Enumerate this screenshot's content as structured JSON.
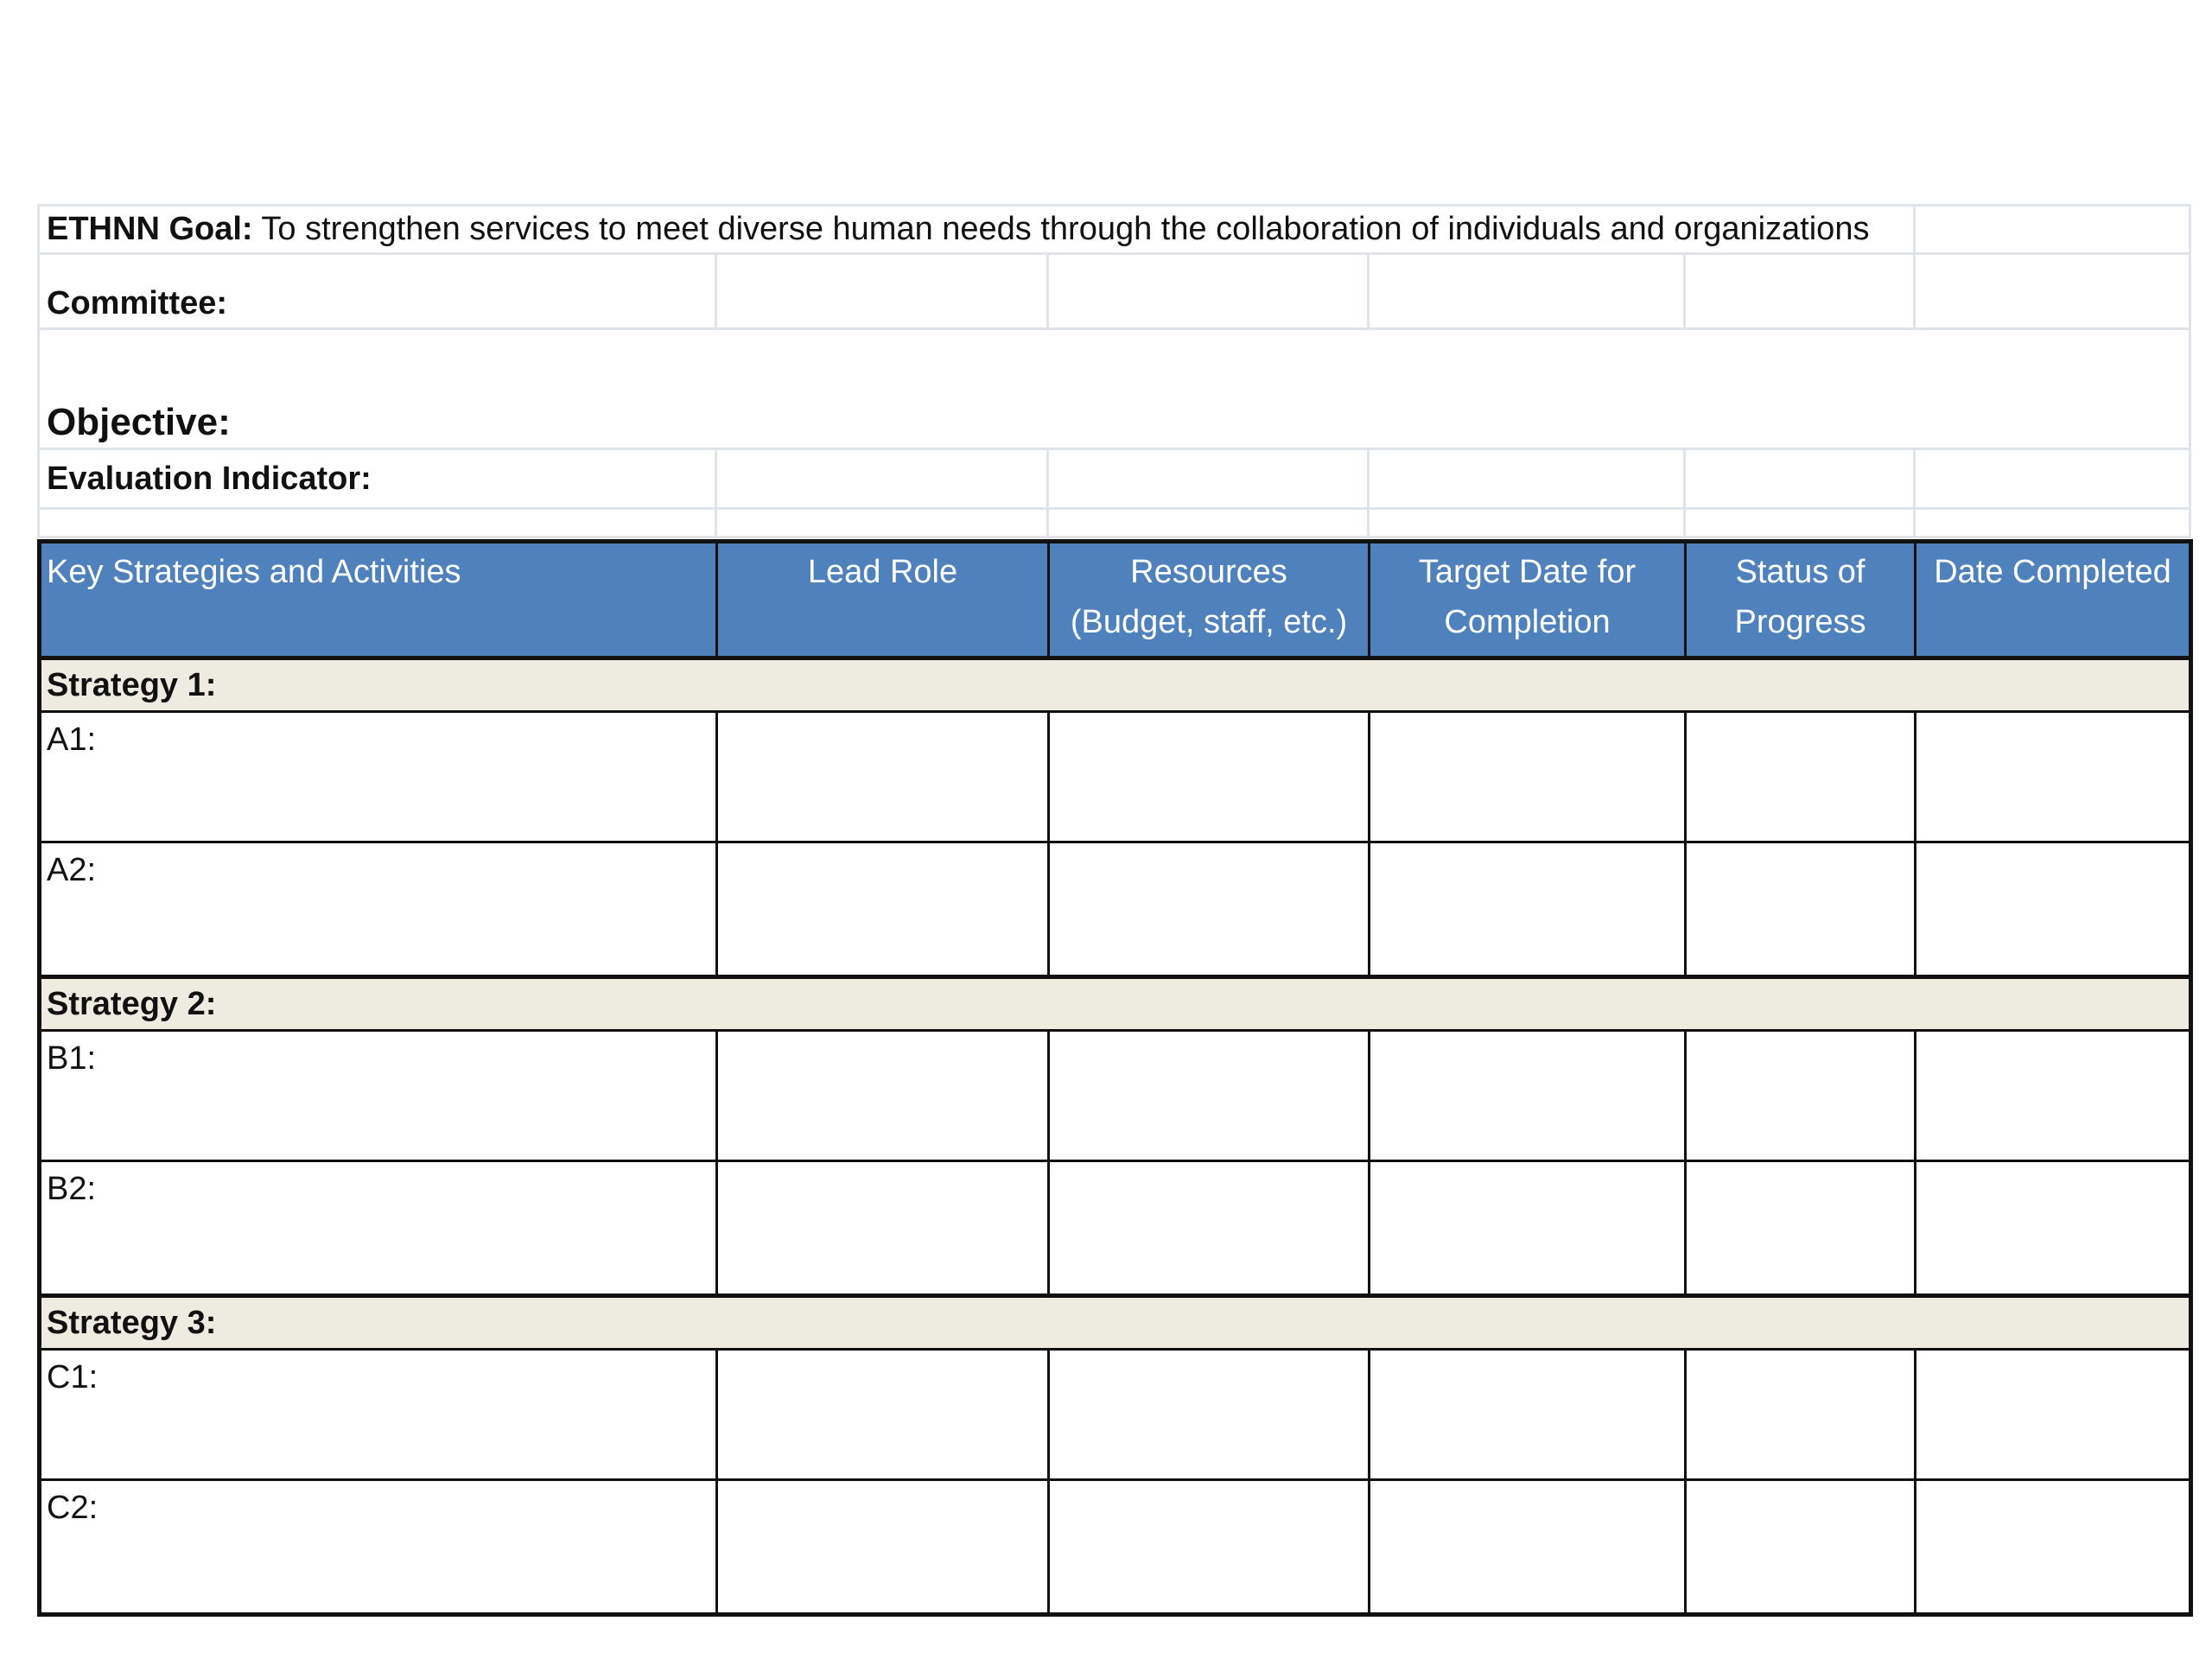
{
  "goal": {
    "label": "ETHNN Goal:",
    "text": " To strengthen services to meet diverse human needs through the collaboration of individuals and organizations"
  },
  "committee": {
    "label": "Committee:"
  },
  "objective": {
    "label": "Objective:"
  },
  "evaluation": {
    "label": "Evaluation Indicator:"
  },
  "plan": {
    "headers": {
      "activities": "Key Strategies and Activities",
      "lead_role": "Lead Role",
      "resources_line1": "Resources",
      "resources_line2": "(Budget, staff, etc.)",
      "target_line1": "Target Date for",
      "target_line2": "Completion",
      "status_line1": "Status of",
      "status_line2": "Progress",
      "date_completed": "Date Completed"
    },
    "strategies": [
      {
        "label": "Strategy 1:",
        "activities": [
          "A1:",
          "A2:"
        ]
      },
      {
        "label": "Strategy 2:",
        "activities": [
          "B1:",
          "B2:"
        ]
      },
      {
        "label": "Strategy 3:",
        "activities": [
          "C1:",
          "C2:"
        ]
      }
    ]
  },
  "colors": {
    "header_fill": "#4f81bd",
    "strategy_fill": "#eeece1",
    "gridline": "#dfe3ea"
  }
}
